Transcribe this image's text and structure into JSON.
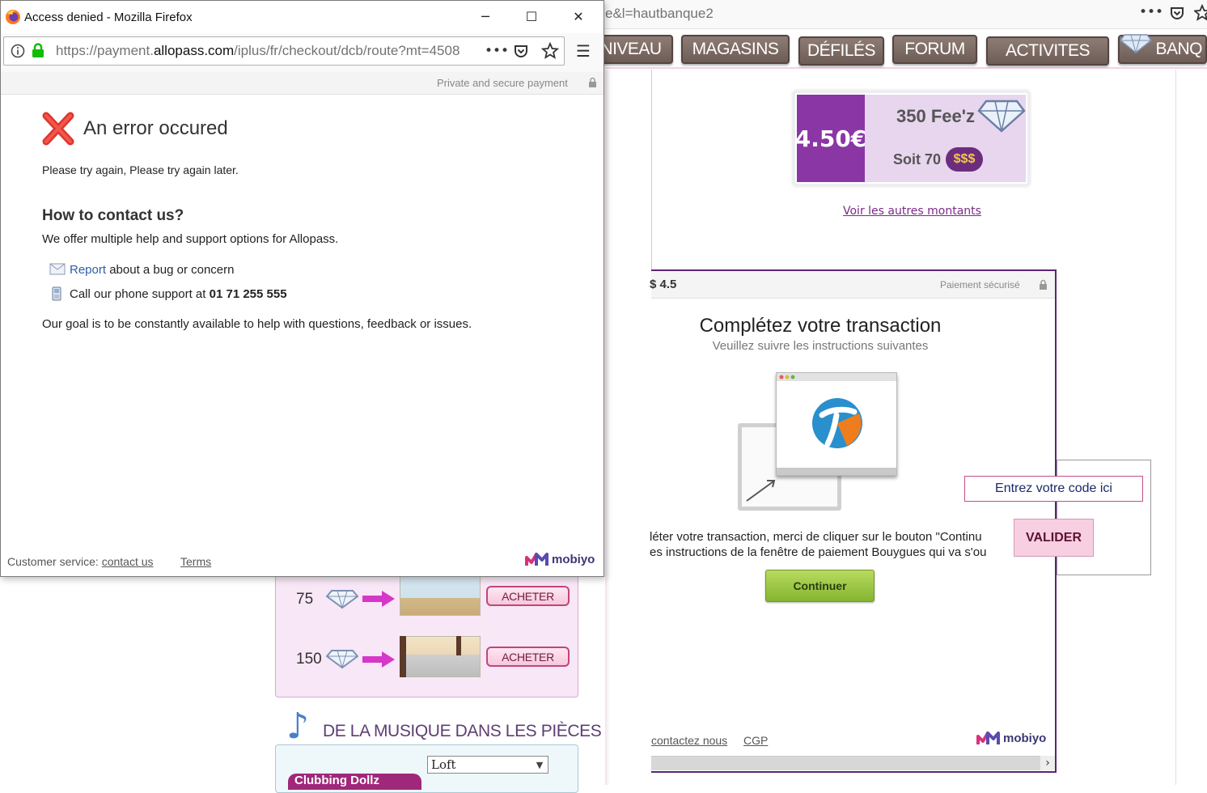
{
  "background_browser": {
    "url_fragment": "e&l=hautbanque2",
    "toolbar_more": "•••",
    "menu": [
      "NIVEAU",
      "MAGASINS",
      "DÉFILÉS",
      "FORUM",
      "ACTIVITES",
      "BANQ"
    ],
    "offer": {
      "price": "4.50€",
      "feez": "350 Fee'z",
      "soit": "Soit 70",
      "dollars": "$$$"
    },
    "other_amounts_link": "Voir les autres montants",
    "payment_frame": {
      "amount": "$ 4.5",
      "secure": "Paiement sécurisé",
      "title": "Complétez votre transaction",
      "subtitle": "Veuillez suivre les instructions suivantes",
      "instruction_1": "léter votre transaction, merci de cliquer sur le bouton \"Continu",
      "instruction_2": "es instructions de la fenêtre de paiement Bouygues qui va s'ou",
      "continue_button": "Continuer",
      "contact_link": "contactez nous",
      "cgp_link": "CGP",
      "scroll_arrow": "›"
    },
    "code_entry": {
      "input_text": "Entrez votre code ici",
      "valider_button": "VALIDER"
    },
    "shop": {
      "rows": [
        {
          "qty": "75",
          "button": "ACHETER"
        },
        {
          "qty": "150",
          "button": "ACHETER"
        }
      ]
    },
    "music": {
      "title": "DE LA MUSIQUE DANS LES PIÈCES",
      "select_value": "Loft",
      "tab_label": "Clubbing Dollz"
    },
    "brand": "mobiyo"
  },
  "popup": {
    "window_title": "Access denied - Mozilla Firefox",
    "url_prefix": "https://payment.",
    "url_domain": "allopass.com",
    "url_path": "/iplus/fr/checkout/dcb/route?mt=4508",
    "url_more": "•••",
    "secure_label": "Private and secure payment",
    "error_title": "An error occured",
    "error_message": "Please try again, Please try again later.",
    "contact_title": "How to contact us?",
    "contact_desc": "We offer multiple help and support options for Allopass.",
    "report_link": "Report",
    "report_rest": " about a bug or concern",
    "phone_prefix": "Call our phone support at ",
    "phone_number": "01 71 255 555",
    "goal": "Our goal is to be constantly available to help with questions, feedback or issues.",
    "footer_label": "Customer service: ",
    "footer_contact": "contact us",
    "footer_terms": "Terms",
    "brand": "mobiyo"
  },
  "colors": {
    "purple": "#8b36a5",
    "frame_border": "#5b2575",
    "green_button": "#84b52f",
    "error_red": "#e0352b",
    "link_blue": "#2e5fa8"
  }
}
